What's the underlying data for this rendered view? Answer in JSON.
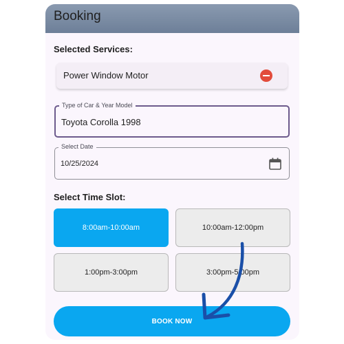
{
  "appbar": {
    "title": "Booking"
  },
  "services": {
    "label": "Selected Services:",
    "items": [
      {
        "name": "Power Window Motor",
        "remove_icon": "remove-circle-icon"
      }
    ]
  },
  "car_field": {
    "label": "Type of Car & Year Model",
    "value": "Toyota Corolla 1998"
  },
  "date_field": {
    "label": "Select Date",
    "value": "10/25/2024",
    "icon": "calendar-icon"
  },
  "time_slots": {
    "label": "Select Time Slot:",
    "slots": [
      {
        "label": "8:00am-10:00am",
        "selected": true
      },
      {
        "label": "10:00am-12:00pm",
        "selected": false
      },
      {
        "label": "1:00pm-3:00pm",
        "selected": false
      },
      {
        "label": "3:00pm-5:00pm",
        "selected": false
      }
    ]
  },
  "book_button": {
    "label": "BOOK NOW"
  },
  "colors": {
    "accent": "#0aa7f0",
    "appbar": "#7b8ca5",
    "remove": "#e24b3b",
    "focused_border": "#6c5a8c",
    "annotation_arrow": "#1a4fa8"
  }
}
